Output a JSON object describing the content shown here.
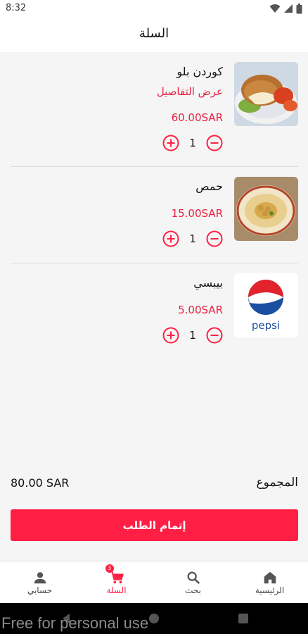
{
  "status_bar": {
    "time": "8:32"
  },
  "app_bar": {
    "title": "السلة"
  },
  "colors": {
    "accent": "#ff1f44",
    "price": "#e8203f"
  },
  "cart": {
    "items": [
      {
        "name": "كوردن بلو",
        "details_link": "عرض التفاصيل",
        "price": "60.00SAR",
        "quantity": "1",
        "image_icon": "cordon-bleu-image"
      },
      {
        "name": "حمص",
        "price": "15.00SAR",
        "quantity": "1",
        "image_icon": "hummus-image"
      },
      {
        "name": "بيبسي",
        "price": "5.00SAR",
        "quantity": "1",
        "image_icon": "pepsi-logo"
      }
    ]
  },
  "summary": {
    "total_label": "المجموع",
    "total_value": "80.00 SAR"
  },
  "checkout": {
    "label": "إتمام الطلب"
  },
  "bottom_nav": {
    "items": [
      {
        "label": "الرئيسية",
        "icon": "home-icon"
      },
      {
        "label": "بحث",
        "icon": "search-icon"
      },
      {
        "label": "السلة",
        "icon": "cart-icon",
        "badge": "3"
      },
      {
        "label": "حسابي",
        "icon": "person-icon"
      }
    ]
  },
  "watermark": "Free for personal use"
}
